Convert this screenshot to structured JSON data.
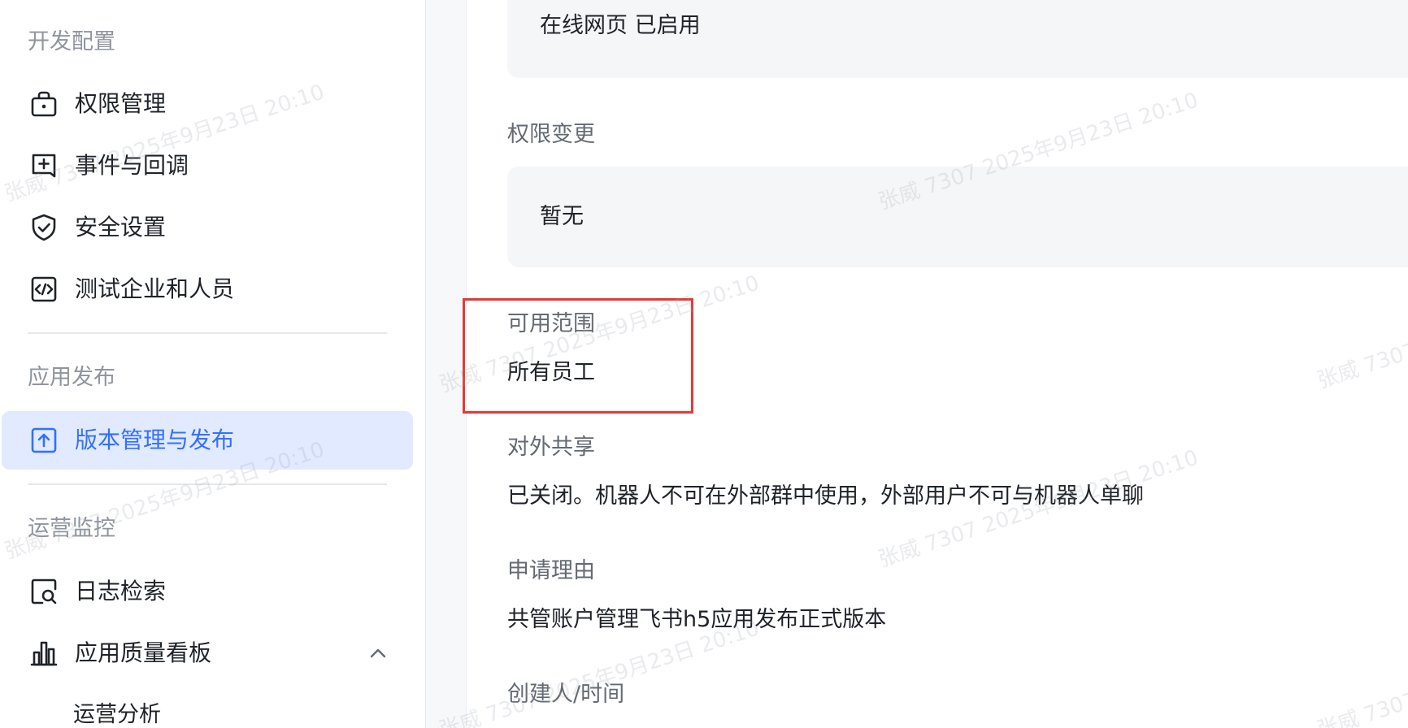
{
  "sidebar": {
    "sections": [
      {
        "title": "开发配置",
        "items": [
          {
            "label": "权限管理",
            "icon": "lock-icon"
          },
          {
            "label": "事件与回调",
            "icon": "plus-box-icon"
          },
          {
            "label": "安全设置",
            "icon": "shield-check-icon"
          },
          {
            "label": "测试企业和人员",
            "icon": "code-box-icon"
          }
        ]
      },
      {
        "title": "应用发布",
        "items": [
          {
            "label": "版本管理与发布",
            "icon": "upload-box-icon",
            "active": true
          }
        ]
      },
      {
        "title": "运营监控",
        "items": [
          {
            "label": "日志检索",
            "icon": "search-doc-icon"
          },
          {
            "label": "应用质量看板",
            "icon": "bar-chart-icon",
            "expanded": true
          }
        ],
        "sub_items": [
          {
            "label": "运营分析"
          }
        ]
      }
    ]
  },
  "main": {
    "web_status_box": {
      "text": "在线网页 已启用"
    },
    "permission_change": {
      "label": "权限变更",
      "value": "暂无"
    },
    "availability": {
      "label": "可用范围",
      "value": "所有员工"
    },
    "external_share": {
      "label": "对外共享",
      "value": "已关闭。机器人不可在外部群中使用，外部用户不可与机器人单聊"
    },
    "reason": {
      "label": "申请理由",
      "value": "共管账户管理飞书h5应用发布正式版本"
    },
    "creator": {
      "label": "创建人/时间"
    }
  },
  "watermark": {
    "text": "张威 7307 2025年9月23日 20:10"
  },
  "colors": {
    "accent": "#3370ff",
    "active_bg": "#e1eaff",
    "highlight": "#e53935",
    "section_title": "#8f959e",
    "field_label": "#646a73"
  }
}
